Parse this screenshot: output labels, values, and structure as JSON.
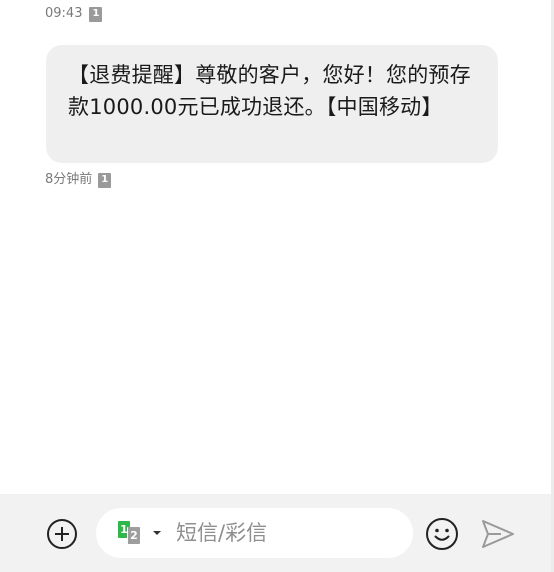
{
  "thread": {
    "timestamp": "09:43",
    "timestamp_sim": "1",
    "message": {
      "text": "【退费提醒】尊敬的客户，您好！您的预存款1000.00元已成功退还。【中国移动】",
      "received": "8分钟前",
      "sim": "1"
    }
  },
  "composer": {
    "placeholder": "短信/彩信",
    "sim_primary": "1",
    "sim_secondary": "2",
    "icons": {
      "add": "plus-circle-icon",
      "emoji": "smiley-icon",
      "send": "send-arrow-icon",
      "sim_dropdown": "caret-down-icon"
    }
  },
  "colors": {
    "bubble_bg": "#efefef",
    "bar_bg": "#f2f2f2",
    "sim_active": "#2fb84a",
    "sim_inactive": "#9e9e9e"
  }
}
